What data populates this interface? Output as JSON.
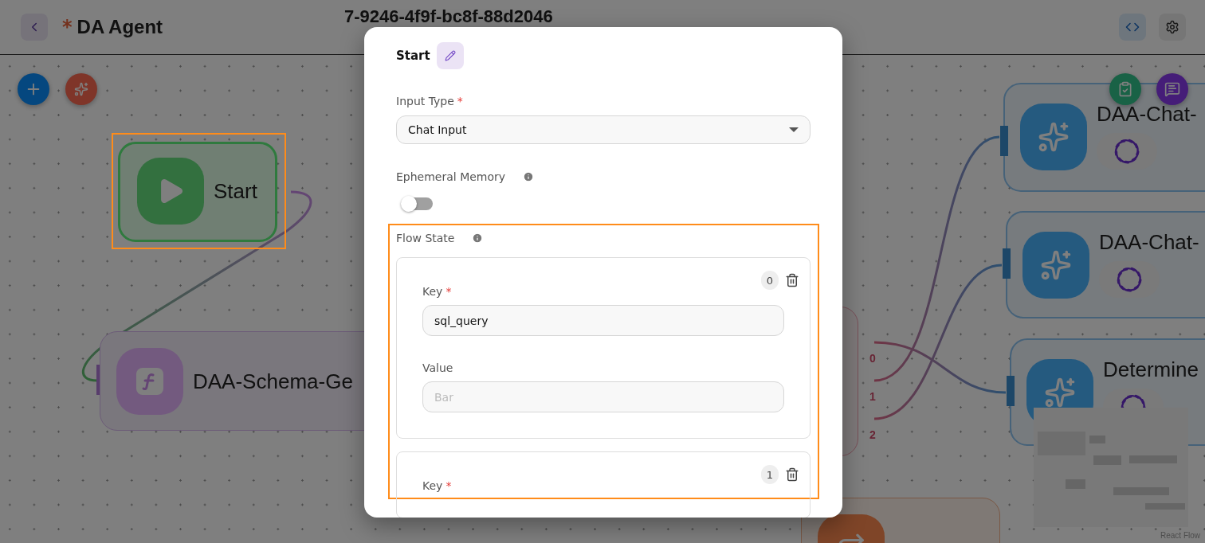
{
  "header": {
    "modified_mark": "*",
    "title": "DA Agent",
    "flow_id": "7-9246-4f9f-bc8f-88d2046"
  },
  "canvas": {
    "nodes": [
      {
        "kind": "start",
        "label": "Start",
        "highlighted": true
      },
      {
        "kind": "function",
        "label": "DAA-Schema-Ge"
      },
      {
        "kind": "condition",
        "outputs": [
          "0",
          "1",
          "2"
        ]
      },
      {
        "kind": "agent",
        "label": "DAA-Chat-"
      },
      {
        "kind": "agent",
        "label": "DAA-Chat-"
      },
      {
        "kind": "agent",
        "label": "Determine"
      },
      {
        "kind": "loop"
      }
    ],
    "attribution": "React Flow"
  },
  "dialog": {
    "title": "Start",
    "fields": [
      {
        "kind": "select",
        "label": "Input Type",
        "required_mark": "*",
        "value": "Chat Input"
      },
      {
        "kind": "toggle",
        "label": "Ephemeral Memory",
        "info": true,
        "on": false
      },
      {
        "kind": "list",
        "label": "Flow State",
        "info": true,
        "highlighted": true,
        "items": [
          {
            "index": "0",
            "fields": [
              {
                "label": "Key",
                "required_mark": "*",
                "value": "sql_query"
              },
              {
                "label": "Value",
                "placeholder": "Bar"
              }
            ]
          },
          {
            "index": "1",
            "fields": [
              {
                "label": "Key",
                "required_mark": "*"
              }
            ]
          }
        ]
      }
    ]
  }
}
